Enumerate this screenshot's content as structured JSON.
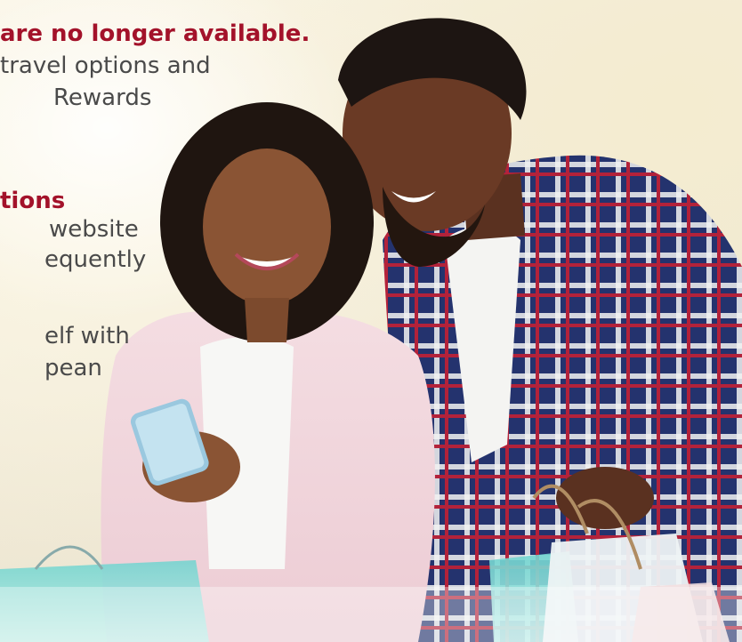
{
  "copy": {
    "lines": [
      "are no longer available.",
      "travel options and",
      "Rewards",
      "tions",
      "website",
      "equently",
      "elf with",
      "pean"
    ]
  },
  "colors": {
    "heading": "#a3122a",
    "body": "#4a4a4a"
  },
  "icons": {
    "shopping-bag": "shopping-bag-icon",
    "phone": "phone-icon"
  }
}
